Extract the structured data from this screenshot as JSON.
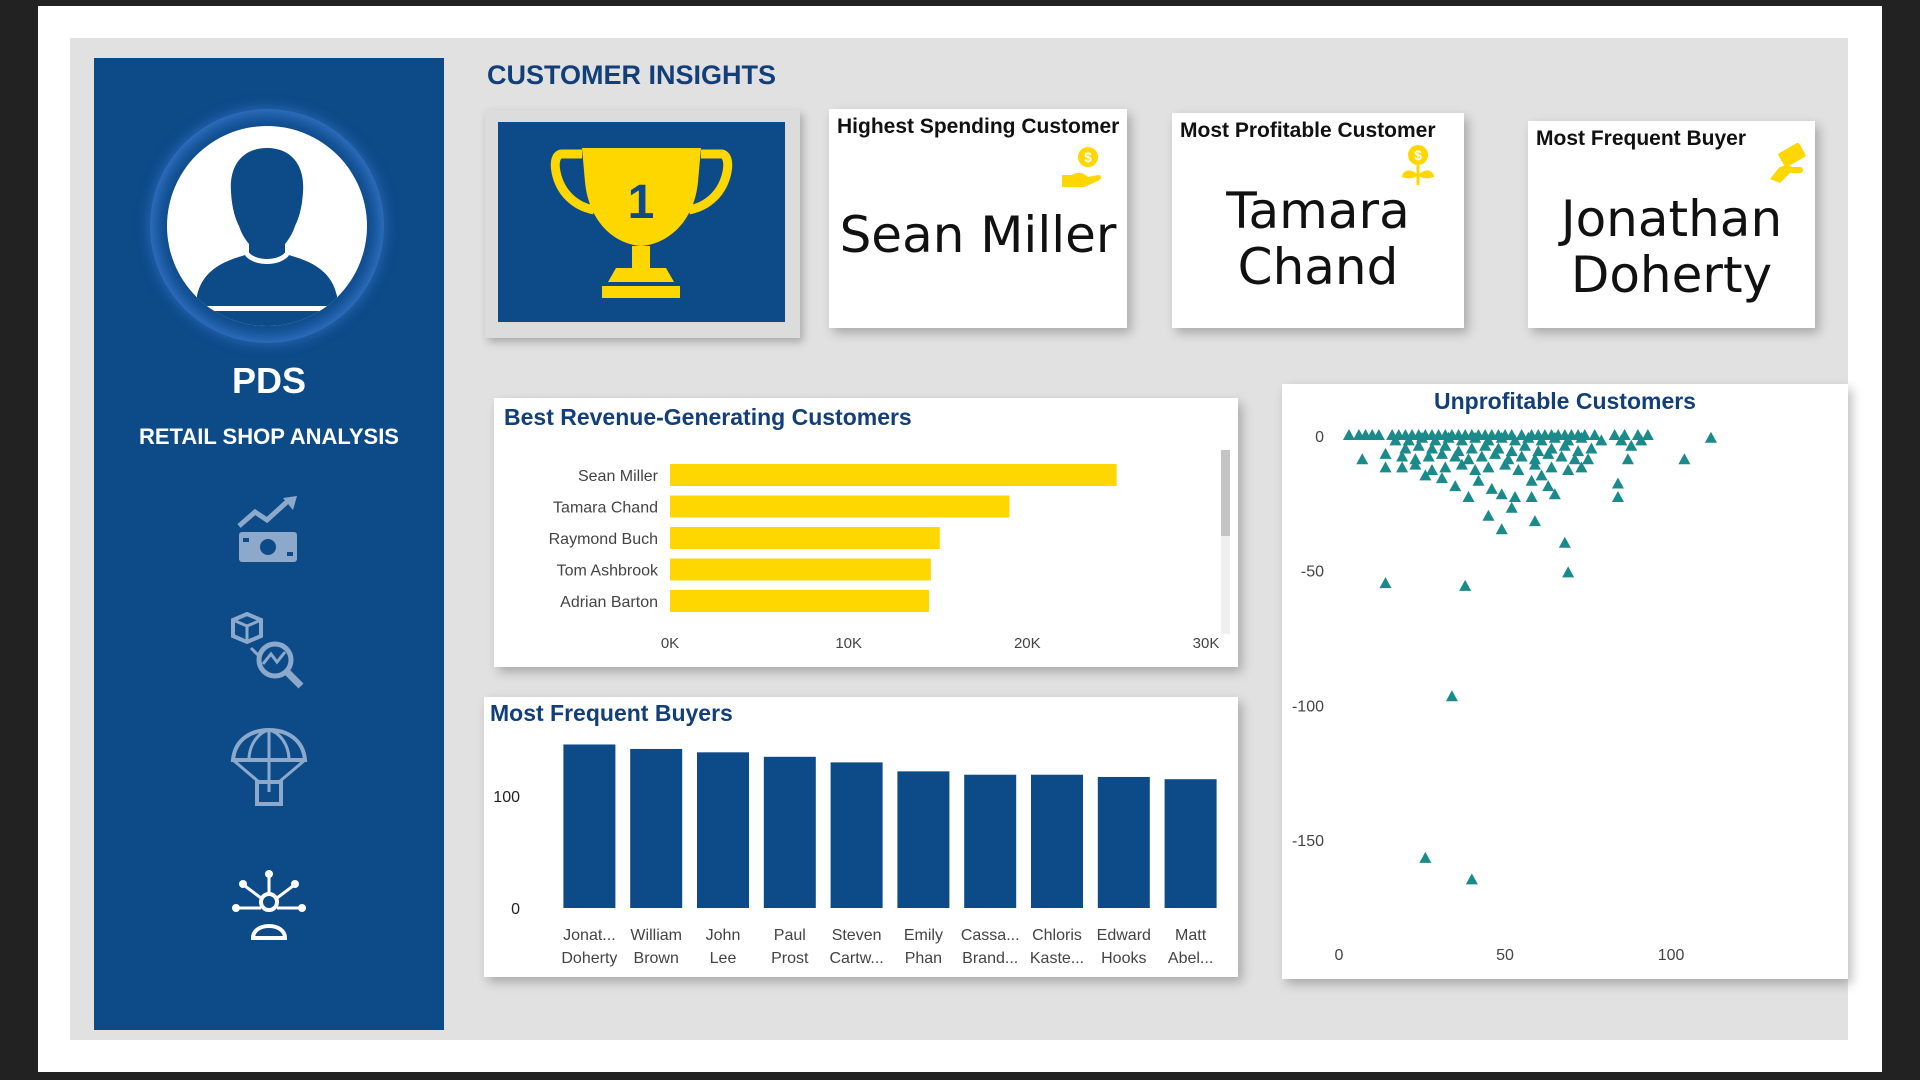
{
  "brand": {
    "title": "PDS",
    "subtitle": "RETAIL SHOP ANALYSIS"
  },
  "nav": [
    {
      "icon": "sales-growth-icon"
    },
    {
      "icon": "product-analysis-icon"
    },
    {
      "icon": "parachute-delivery-icon"
    },
    {
      "icon": "customer-insights-icon",
      "active": true
    }
  ],
  "page": {
    "title": "CUSTOMER INSIGHTS"
  },
  "trophy": {
    "rank": "1",
    "icon": "trophy-icon"
  },
  "kpis": {
    "highest_spending": {
      "label": "Highest Spending Customer",
      "lines": [
        "Sean Miller"
      ],
      "icon": "money-hand-icon"
    },
    "most_profitable": {
      "label": "Most Profitable Customer",
      "lines": [
        "Tamara",
        "Chand"
      ],
      "icon": "money-plant-icon"
    },
    "most_frequent": {
      "label": "Most Frequent Buyer",
      "lines": [
        "Jonathan",
        "Doherty"
      ],
      "icon": "cash-hand-icon"
    }
  },
  "colors": {
    "sidebar": "#0c4a88",
    "accent_yellow": "#ffd700",
    "navy": "#0c4a88",
    "teal": "#1a8a8a",
    "title": "#123f7a"
  },
  "chart_data": [
    {
      "type": "bar",
      "orientation": "horizontal",
      "title": "Best Revenue-Generating Customers",
      "categories": [
        "Sean Miller",
        "Tamara Chand",
        "Raymond Buch",
        "Tom Ashbrook",
        "Adrian Barton"
      ],
      "values": [
        25000,
        19000,
        15100,
        14600,
        14500
      ],
      "xlim": [
        0,
        30000
      ],
      "xticks": [
        "0K",
        "10K",
        "20K",
        "30K"
      ],
      "color": "#ffd700"
    },
    {
      "type": "bar",
      "title": "Most Frequent Buyers",
      "categories": [
        [
          "Jonat...",
          "Doherty"
        ],
        [
          "William",
          "Brown"
        ],
        [
          "John",
          "Lee"
        ],
        [
          "Paul",
          "Prost"
        ],
        [
          "Steven",
          "Cartw..."
        ],
        [
          "Emily",
          "Phan"
        ],
        [
          "Cassa...",
          "Brand..."
        ],
        [
          "Chloris",
          "Kaste..."
        ],
        [
          "Edward",
          "Hooks"
        ],
        [
          "Matt",
          "Abel..."
        ]
      ],
      "values": [
        146,
        142,
        139,
        135,
        130,
        122,
        119,
        119,
        117,
        115
      ],
      "ylim": [
        0,
        150
      ],
      "yticks": [
        0,
        100
      ],
      "color": "#0c4a88"
    },
    {
      "type": "scatter",
      "title": "Unprofitable Customers",
      "marker": "triangle",
      "color": "#1a8a8a",
      "xlim": [
        0,
        120
      ],
      "ylim": [
        -175,
        5
      ],
      "xticks": [
        0,
        50,
        100
      ],
      "yticks": [
        0,
        -50,
        -100,
        -150
      ],
      "points": [
        [
          3,
          0
        ],
        [
          6,
          0
        ],
        [
          8,
          0
        ],
        [
          10,
          0
        ],
        [
          12,
          0
        ],
        [
          16,
          0
        ],
        [
          18,
          0
        ],
        [
          20,
          0
        ],
        [
          22,
          0
        ],
        [
          24,
          0
        ],
        [
          26,
          0
        ],
        [
          28,
          0
        ],
        [
          30,
          0
        ],
        [
          32,
          0
        ],
        [
          34,
          0
        ],
        [
          36,
          0
        ],
        [
          38,
          0
        ],
        [
          40,
          0
        ],
        [
          42,
          0
        ],
        [
          44,
          0
        ],
        [
          46,
          0
        ],
        [
          48,
          0
        ],
        [
          50,
          0
        ],
        [
          52,
          0
        ],
        [
          55,
          0
        ],
        [
          58,
          0
        ],
        [
          60,
          0
        ],
        [
          62,
          0
        ],
        [
          64,
          0
        ],
        [
          66,
          0
        ],
        [
          68,
          0
        ],
        [
          70,
          0
        ],
        [
          72,
          0
        ],
        [
          74,
          0
        ],
        [
          77,
          0
        ],
        [
          83,
          0
        ],
        [
          86,
          0
        ],
        [
          90,
          0
        ],
        [
          93,
          0
        ],
        [
          17,
          -2
        ],
        [
          21,
          -2
        ],
        [
          25,
          -1
        ],
        [
          29,
          -2
        ],
        [
          33,
          -1
        ],
        [
          37,
          -2
        ],
        [
          41,
          -1
        ],
        [
          45,
          -2
        ],
        [
          49,
          -1
        ],
        [
          53,
          -2
        ],
        [
          57,
          -1
        ],
        [
          61,
          -2
        ],
        [
          65,
          -1
        ],
        [
          69,
          -2
        ],
        [
          73,
          -1
        ],
        [
          79,
          -2
        ],
        [
          85,
          -2
        ],
        [
          91,
          -2
        ],
        [
          20,
          -5
        ],
        [
          24,
          -4
        ],
        [
          28,
          -5
        ],
        [
          32,
          -4
        ],
        [
          36,
          -6
        ],
        [
          40,
          -5
        ],
        [
          44,
          -4
        ],
        [
          48,
          -5
        ],
        [
          52,
          -6
        ],
        [
          56,
          -4
        ],
        [
          60,
          -6
        ],
        [
          64,
          -5
        ],
        [
          68,
          -4
        ],
        [
          72,
          -6
        ],
        [
          76,
          -5
        ],
        [
          88,
          -4
        ],
        [
          7,
          -9
        ],
        [
          14,
          -7
        ],
        [
          19,
          -8
        ],
        [
          23,
          -9
        ],
        [
          27,
          -8
        ],
        [
          31,
          -7
        ],
        [
          35,
          -8
        ],
        [
          39,
          -9
        ],
        [
          43,
          -8
        ],
        [
          47,
          -7
        ],
        [
          51,
          -9
        ],
        [
          55,
          -8
        ],
        [
          59,
          -9
        ],
        [
          63,
          -7
        ],
        [
          67,
          -8
        ],
        [
          71,
          -9
        ],
        [
          75,
          -9
        ],
        [
          87,
          -9
        ],
        [
          104,
          -9
        ],
        [
          19,
          -12
        ],
        [
          23,
          -11
        ],
        [
          28,
          -13
        ],
        [
          32,
          -12
        ],
        [
          37,
          -11
        ],
        [
          41,
          -13
        ],
        [
          45,
          -12
        ],
        [
          50,
          -11
        ],
        [
          54,
          -13
        ],
        [
          59,
          -11
        ],
        [
          64,
          -12
        ],
        [
          69,
          -13
        ],
        [
          73,
          -12
        ],
        [
          14,
          -12
        ],
        [
          26,
          -15
        ],
        [
          31,
          -16
        ],
        [
          35,
          -19
        ],
        [
          42,
          -17
        ],
        [
          46,
          -20
        ],
        [
          49,
          -22
        ],
        [
          58,
          -17
        ],
        [
          61,
          -15
        ],
        [
          63,
          -19
        ],
        [
          84,
          -18
        ],
        [
          39,
          -23
        ],
        [
          53,
          -23
        ],
        [
          58,
          -23
        ],
        [
          65,
          -22
        ],
        [
          84,
          -23
        ],
        [
          45,
          -30
        ],
        [
          52,
          -27
        ],
        [
          59,
          -32
        ],
        [
          49,
          -35
        ],
        [
          68,
          -40
        ],
        [
          69,
          -51
        ],
        [
          14,
          -55
        ],
        [
          38,
          -56
        ],
        [
          34,
          -97
        ],
        [
          26,
          -157
        ],
        [
          40,
          -165
        ],
        [
          112,
          -1
        ]
      ]
    }
  ]
}
